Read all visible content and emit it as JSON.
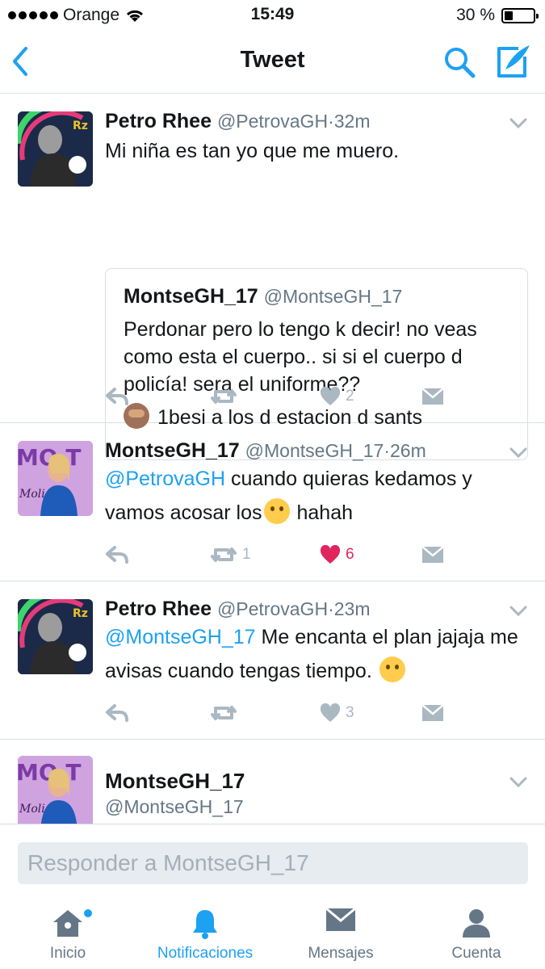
{
  "status_bar": {
    "carrier": "Orange",
    "time": "15:49",
    "battery": "30 %",
    "battery_level": 0.3
  },
  "nav": {
    "title": "Tweet"
  },
  "tweets": [
    {
      "name": "Petro Rhee",
      "handle": "@PetrovaGH",
      "sep": "·",
      "time": "32m",
      "text": "Mi niña es tan yo que me muero.",
      "quote": {
        "name": "MontseGH_17",
        "handle": "@MontseGH_17",
        "line1": "Perdonar pero lo tengo k decir! no veas como esta el cuerpo.. si si el cuerpo d policía! sera el uniforme??",
        "line2": "1besi a los d estacion d sants"
      },
      "retweets": "",
      "likes": "2"
    },
    {
      "name": "MontseGH_17",
      "handle": "@MontseGH_17",
      "sep": "·",
      "time": "26m",
      "mention": "@PetrovaGH",
      "text_a": " cuando quieras kedamos y vamos acosar los",
      "text_b": " hahah",
      "retweets": "1",
      "likes": "6"
    },
    {
      "name": "Petro Rhee",
      "handle": "@PetrovaGH",
      "sep": "·",
      "time": "23m",
      "mention": "@MontseGH_17",
      "text_a": " Me encanta el plan jajaja me avisas cuando tengas tiempo. ",
      "retweets": "",
      "likes": "3"
    },
    {
      "name": "MontseGH_17",
      "handle": "@MontseGH_17"
    }
  ],
  "reply": {
    "placeholder": "Responder a MontseGH_17"
  },
  "tabs": [
    {
      "label": "Inicio",
      "icon": "home-icon"
    },
    {
      "label": "Notificaciones",
      "icon": "bell-icon"
    },
    {
      "label": "Mensajes",
      "icon": "envelope-icon"
    },
    {
      "label": "Cuenta",
      "icon": "person-icon"
    }
  ],
  "colors": {
    "accent": "#1da1f2",
    "like": "#e0245e",
    "muted": "#657786",
    "icon_gray": "#aab8c2"
  }
}
